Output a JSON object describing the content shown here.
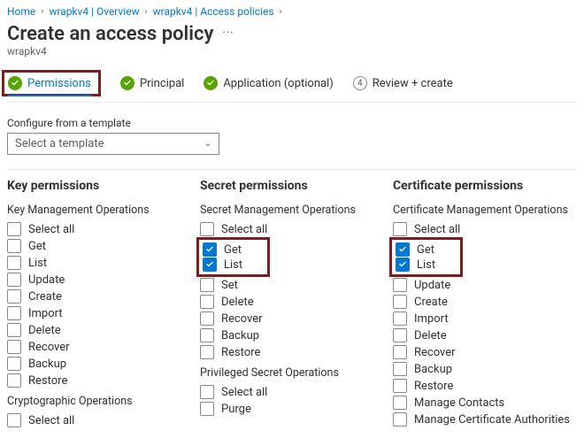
{
  "breadcrumb": {
    "home": "Home",
    "overview": "wrapkv4 | Overview",
    "policies": "wrapkv4 | Access policies"
  },
  "title": "Create an access policy",
  "subtitle": "wrapkv4",
  "more_label": "···",
  "steps": {
    "permissions": "Permissions",
    "principal": "Principal",
    "application": "Application (optional)",
    "review_num": "4",
    "review": "Review + create"
  },
  "template": {
    "label": "Configure from a template",
    "placeholder": "Select a template"
  },
  "common": {
    "select_all": "Select all",
    "get": "Get",
    "list": "List",
    "update": "Update",
    "create": "Create",
    "import": "Import",
    "delete": "Delete",
    "recover": "Recover",
    "backup": "Backup",
    "restore": "Restore",
    "set": "Set",
    "purge": "Purge",
    "manage_contacts": "Manage Contacts",
    "manage_ca": "Manage Certificate Authorities"
  },
  "headings": {
    "key_perms": "Key permissions",
    "secret_perms": "Secret permissions",
    "cert_perms": "Certificate permissions",
    "key_mgmt": "Key Management Operations",
    "secret_mgmt": "Secret Management Operations",
    "cert_mgmt": "Certificate Management Operations",
    "crypto_ops": "Cryptographic Operations",
    "priv_secret_ops": "Privileged Secret Operations"
  },
  "checked": {
    "secret_get": true,
    "secret_list": true,
    "cert_get": true,
    "cert_list": true
  }
}
